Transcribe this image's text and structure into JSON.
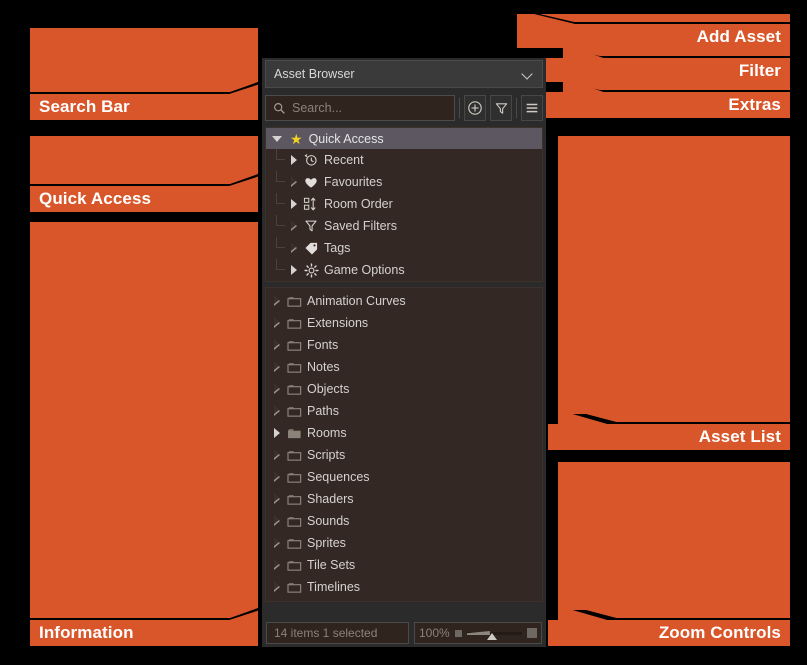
{
  "theme": {
    "accent": "#d9562a",
    "background": "#000000",
    "panel_bg": "#2b2b2b",
    "tree_bg": "#332824"
  },
  "annotations": [
    {
      "label": "Add Asset",
      "side": "right"
    },
    {
      "label": "Filter",
      "side": "right"
    },
    {
      "label": "Extras",
      "side": "right"
    },
    {
      "label": "Asset List",
      "side": "right"
    },
    {
      "label": "Zoom Controls",
      "side": "right"
    },
    {
      "label": "Search Bar",
      "side": "left"
    },
    {
      "label": "Quick Access",
      "side": "left"
    },
    {
      "label": "Information",
      "side": "left"
    }
  ],
  "panel": {
    "header": {
      "title": "Asset Browser",
      "chevron_icon": "chevron-down-icon"
    },
    "toolbar": {
      "search": {
        "placeholder": "Search...",
        "value": "",
        "icon": "search-icon"
      },
      "buttons": [
        {
          "name": "add-asset-button",
          "icon": "plus-circle-icon"
        },
        {
          "name": "filter-button",
          "icon": "funnel-icon"
        },
        {
          "name": "extras-button",
          "icon": "hamburger-menu-icon"
        }
      ]
    },
    "quick_access": {
      "header": {
        "label": "Quick Access",
        "icon": "star-icon",
        "expanded": true
      },
      "items": [
        {
          "label": "Recent",
          "icon": "clock-rewind-icon",
          "expandable": "filled"
        },
        {
          "label": "Favourites",
          "icon": "heart-icon",
          "expandable": "hollow"
        },
        {
          "label": "Room Order",
          "icon": "room-order-icon",
          "expandable": "filled"
        },
        {
          "label": "Saved Filters",
          "icon": "funnel-icon",
          "expandable": "hollow"
        },
        {
          "label": "Tags",
          "icon": "tag-icon",
          "expandable": "hollow"
        },
        {
          "label": "Game Options",
          "icon": "gear-icon",
          "expandable": "filled"
        }
      ]
    },
    "folders": [
      {
        "label": "Animation Curves",
        "icon": "folder-icon",
        "expandable": "hollow"
      },
      {
        "label": "Extensions",
        "icon": "folder-icon",
        "expandable": "hollow"
      },
      {
        "label": "Fonts",
        "icon": "folder-icon",
        "expandable": "hollow"
      },
      {
        "label": "Notes",
        "icon": "folder-icon",
        "expandable": "hollow"
      },
      {
        "label": "Objects",
        "icon": "folder-icon",
        "expandable": "hollow"
      },
      {
        "label": "Paths",
        "icon": "folder-icon",
        "expandable": "hollow"
      },
      {
        "label": "Rooms",
        "icon": "folder-full-icon",
        "expandable": "filled"
      },
      {
        "label": "Scripts",
        "icon": "folder-icon",
        "expandable": "hollow"
      },
      {
        "label": "Sequences",
        "icon": "folder-icon",
        "expandable": "hollow"
      },
      {
        "label": "Shaders",
        "icon": "folder-icon",
        "expandable": "hollow"
      },
      {
        "label": "Sounds",
        "icon": "folder-icon",
        "expandable": "hollow"
      },
      {
        "label": "Sprites",
        "icon": "folder-icon",
        "expandable": "hollow"
      },
      {
        "label": "Tile Sets",
        "icon": "folder-icon",
        "expandable": "hollow"
      },
      {
        "label": "Timelines",
        "icon": "folder-icon",
        "expandable": "hollow"
      }
    ],
    "status": {
      "item_count": "14 items",
      "selection": "1 selected",
      "item_count_full": "14 items    1 selected",
      "zoom_level": "100%"
    }
  }
}
